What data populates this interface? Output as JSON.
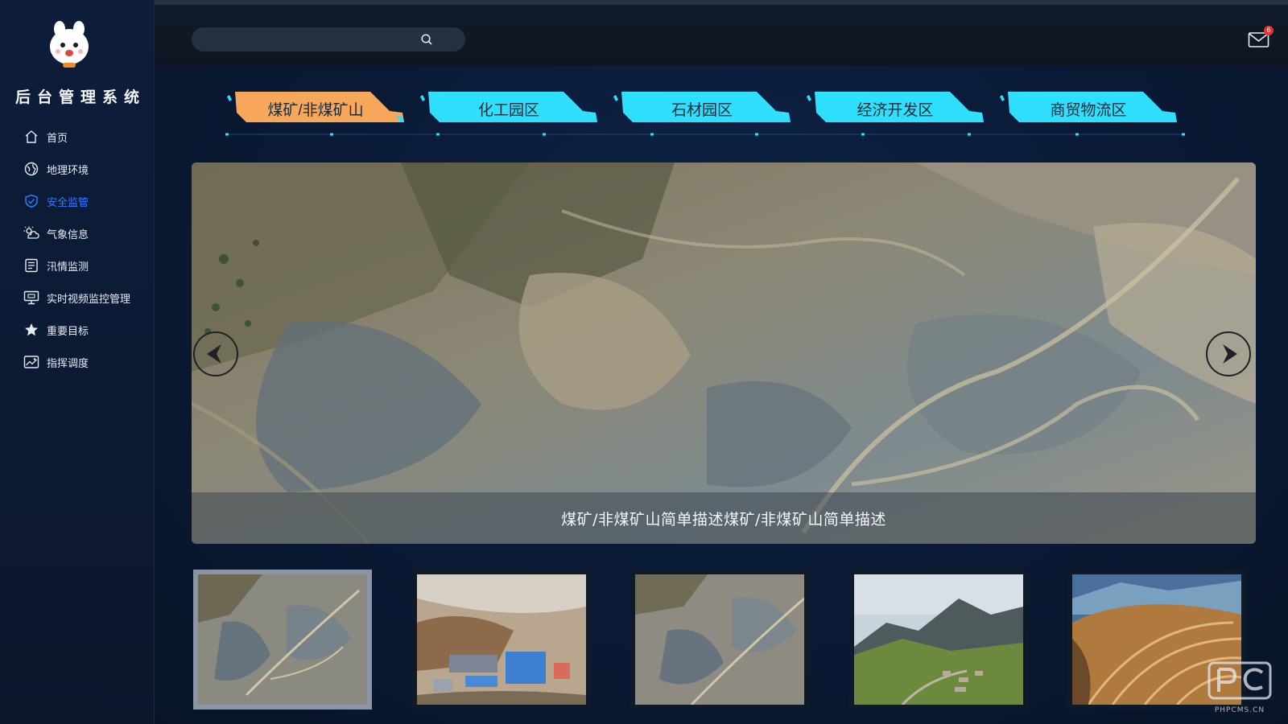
{
  "app": {
    "title": "后台管理系统"
  },
  "sidebar": {
    "items": [
      {
        "label": "首页",
        "icon": "home-icon",
        "active": false
      },
      {
        "label": "地理环境",
        "icon": "globe-icon",
        "active": false
      },
      {
        "label": "安全监管",
        "icon": "shield-icon",
        "active": true
      },
      {
        "label": "气象信息",
        "icon": "weather-icon",
        "active": false
      },
      {
        "label": "汛情监测",
        "icon": "report-icon",
        "active": false
      },
      {
        "label": "实时视频监控管理",
        "icon": "monitor-icon",
        "active": false
      },
      {
        "label": "重要目标",
        "icon": "star-icon",
        "active": false
      },
      {
        "label": "指挥调度",
        "icon": "image-chart-icon",
        "active": false
      }
    ]
  },
  "header": {
    "search": {
      "placeholder": "",
      "value": ""
    },
    "mail": {
      "badge": "6"
    }
  },
  "tabs": [
    {
      "label": "煤矿/非煤矿山",
      "active": true
    },
    {
      "label": "化工园区",
      "active": false
    },
    {
      "label": "石材园区",
      "active": false
    },
    {
      "label": "经济开发区",
      "active": false
    },
    {
      "label": "商贸物流区",
      "active": false
    }
  ],
  "carousel": {
    "caption": "煤矿/非煤矿山简单描述煤矿/非煤矿山简单描述"
  },
  "thumbnails": [
    {
      "subject": "quarry-aerial",
      "selected": true
    },
    {
      "subject": "industrial-site",
      "selected": false
    },
    {
      "subject": "quarry-aerial",
      "selected": false
    },
    {
      "subject": "mountain-valley",
      "selected": false
    },
    {
      "subject": "terraced-hills",
      "selected": false
    }
  ],
  "watermark": {
    "text": "PHPCMS.CN"
  },
  "colors": {
    "accent_active_tab": "#f7a75a",
    "accent_tab": "#2ee0fb",
    "active_menu": "#2f7bff",
    "badge": "#e8312f"
  }
}
